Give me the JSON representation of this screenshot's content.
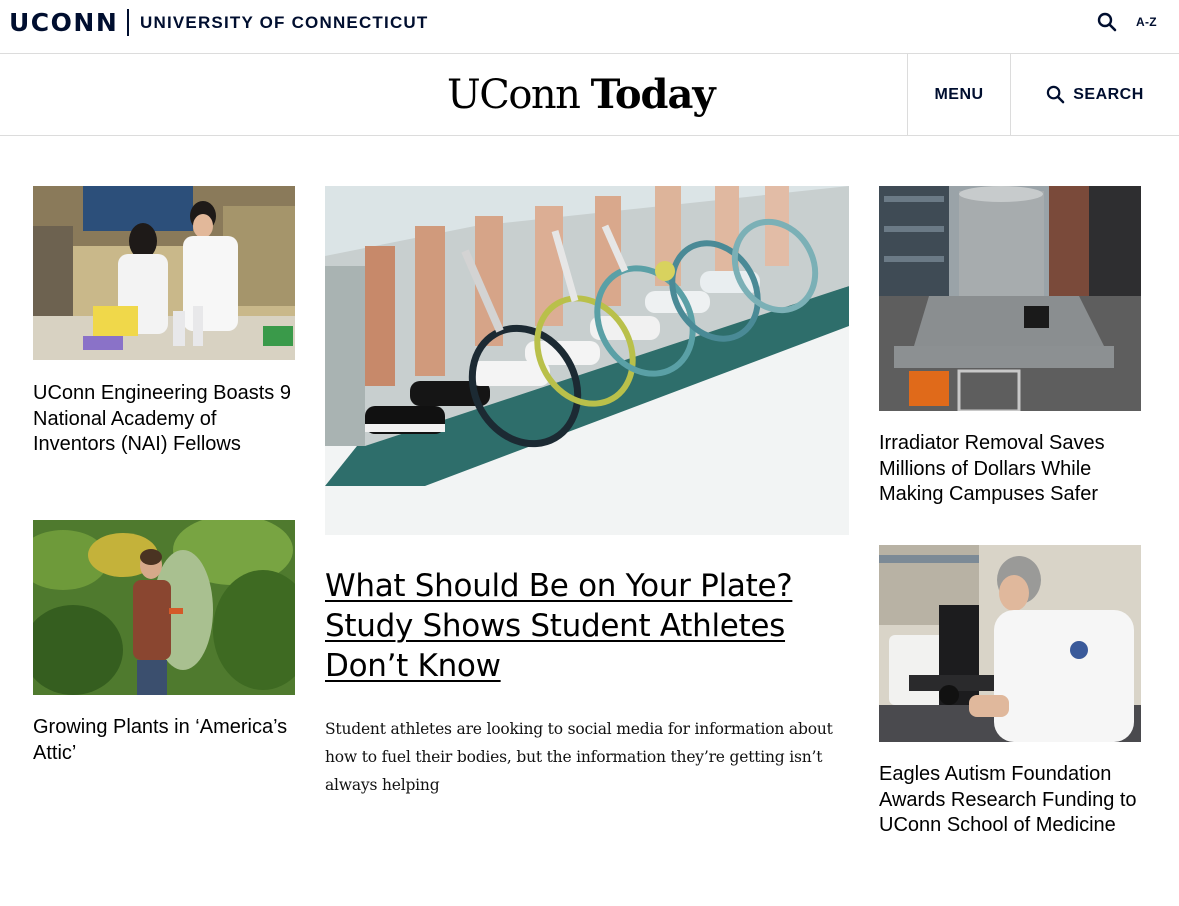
{
  "university_bar": {
    "wordmark": "UCONN",
    "name": "UNIVERSITY OF CONNECTICUT",
    "search_icon": "search-icon",
    "az_label": "A-Z"
  },
  "site_header": {
    "logo_light": "UConn",
    "logo_bold": "Today",
    "menu_label": "MENU",
    "search_label": "SEARCH",
    "search_icon": "search-icon"
  },
  "articles": {
    "left": [
      {
        "title": "UConn Engineering Boasts 9 National Academy of Inventors (NAI) Fellows"
      },
      {
        "title": "Growing Plants in ‘America’s Attic’"
      }
    ],
    "feature": {
      "title": "What Should Be on Your Plate? Study Shows Student Athletes Don’t Know",
      "dek": "Student athletes are looking to social media for information about how to fuel their bodies, but the information they’re getting isn’t always helping"
    },
    "right": [
      {
        "title": "Irradiator Removal Saves Millions of Dollars While Making Campuses Safer"
      },
      {
        "title": "Eagles Autism Foundation Awards Research Funding to UConn School of Medicine"
      }
    ]
  },
  "colors": {
    "navy": "#000e2f",
    "divider": "#dcdcdc",
    "court_green": "#2e6e6b"
  }
}
